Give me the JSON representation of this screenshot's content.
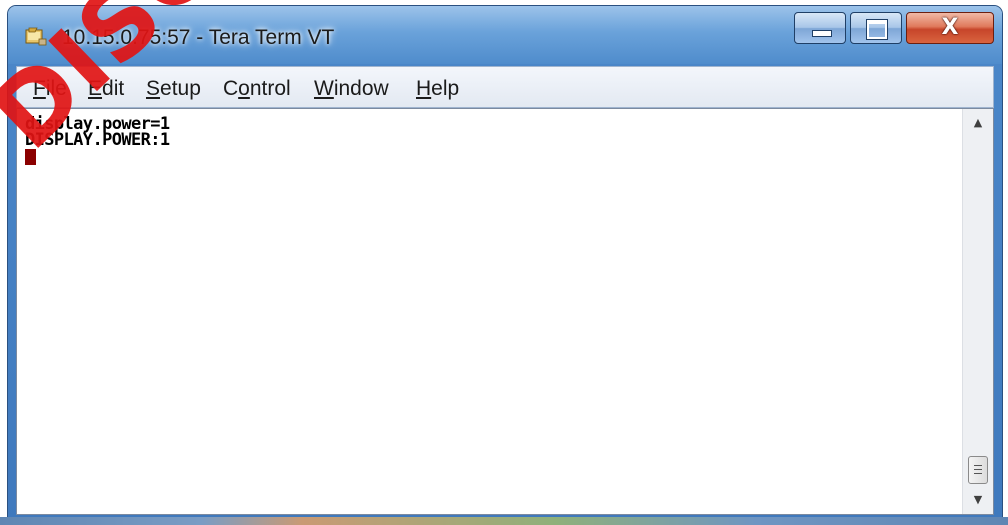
{
  "window": {
    "title": "10.15.0.75:57 - Tera Term VT",
    "app_icon": "tera-term-icon",
    "controls": {
      "minimize_icon": "minimize-icon",
      "maximize_icon": "maximize-icon",
      "close_icon": "close-icon",
      "close_glyph": "X"
    }
  },
  "menubar": {
    "items": [
      {
        "mnemonic": "F",
        "rest": "ile"
      },
      {
        "mnemonic": "E",
        "rest": "dit"
      },
      {
        "mnemonic": "S",
        "rest": "etup"
      },
      {
        "pre": "C",
        "mnemonic": "o",
        "rest": "ntrol"
      },
      {
        "mnemonic": "W",
        "rest": "indow"
      },
      {
        "mnemonic": "H",
        "rest": "elp"
      }
    ]
  },
  "terminal": {
    "lines": [
      "display.power=1",
      "DISPLAY.POWER:1"
    ],
    "cursor_color": "#8b0000"
  },
  "scrollbar": {
    "up_icon": "scroll-up-arrow-icon",
    "down_icon": "scroll-down-arrow-icon"
  },
  "overlay": {
    "watermark_text": "DISCO",
    "watermark_color": "#e11414"
  }
}
